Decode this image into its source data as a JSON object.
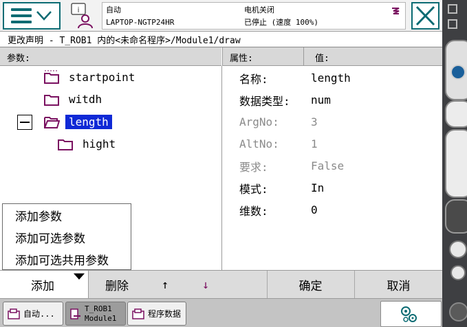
{
  "header": {
    "mode": "自动",
    "controller": "LAPTOP-NGTP24HR",
    "motor_status": "电机关闭",
    "run_status": "已停止 (速度 100%)"
  },
  "title": "更改声明 - T_ROB1 内的<未命名程序>/Module1/draw",
  "panel": {
    "params_header": "参数:",
    "attr_header": "属性:",
    "value_header": "值:"
  },
  "tree": [
    {
      "label": "startpoint",
      "selected": false
    },
    {
      "label": "witdh",
      "selected": false
    },
    {
      "label": "length",
      "selected": true
    },
    {
      "label": "hight",
      "selected": false
    }
  ],
  "properties": [
    {
      "name": "名称:",
      "value": "length",
      "dim": false
    },
    {
      "name": "数据类型:",
      "value": "num",
      "dim": false
    },
    {
      "name": "ArgNo:",
      "value": "3",
      "dim": true
    },
    {
      "name": "AltNo:",
      "value": "1",
      "dim": true
    },
    {
      "name": "要求:",
      "value": "False",
      "dim": true
    },
    {
      "name": "模式:",
      "value": "In",
      "dim": false
    },
    {
      "name": "维数:",
      "value": "0",
      "dim": false
    }
  ],
  "popup_menu": [
    "添加参数",
    "添加可选参数",
    "添加可选共用参数"
  ],
  "commands": {
    "add": "添加",
    "delete": "删除",
    "up": "↑",
    "down": "↓",
    "ok": "确定",
    "cancel": "取消"
  },
  "taskbar": {
    "task1": "自动...",
    "task2_line1": "T_ROB1",
    "task2_line2": "Module1",
    "task3": "程序数据"
  },
  "colors": {
    "accent": "#0b6b73",
    "selection": "#0f29d6",
    "folder": "#7a1060"
  }
}
